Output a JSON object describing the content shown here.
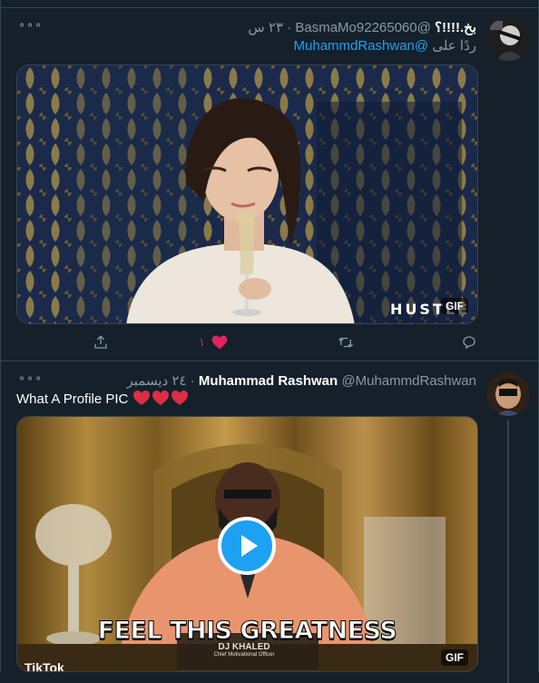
{
  "tweets": [
    {
      "author_name": "بخ.!!!!؟",
      "handle": "@BasmaMo92265060",
      "separator": "·",
      "time": "٢٣ س",
      "reply_prefix": "ردًا على",
      "reply_to": "@MuhammdRashwan",
      "more_label": "⚬⚬⚬",
      "media": {
        "badge": "GIF",
        "watermark": "HUSTLE"
      },
      "actions": {
        "like_count": "١"
      }
    },
    {
      "author_name": "Muhammad Rashwan",
      "handle": "@MuhammdRashwan",
      "separator": "·",
      "time": "٢٤ ديسمبر",
      "text": "What A Profile PIC",
      "more_label": "⚬⚬⚬",
      "media": {
        "badge": "GIF",
        "caption": "FEEL THIS GREATNESS",
        "name_plate": "DJ KHALED",
        "name_plate_sub": "Chief Motivational Officer",
        "watermark": "TikTok"
      }
    }
  ],
  "colors": {
    "background": "#15202b",
    "border": "#38444d",
    "muted": "#8899a6",
    "accent": "#1da1f2",
    "like": "#e0245e"
  }
}
